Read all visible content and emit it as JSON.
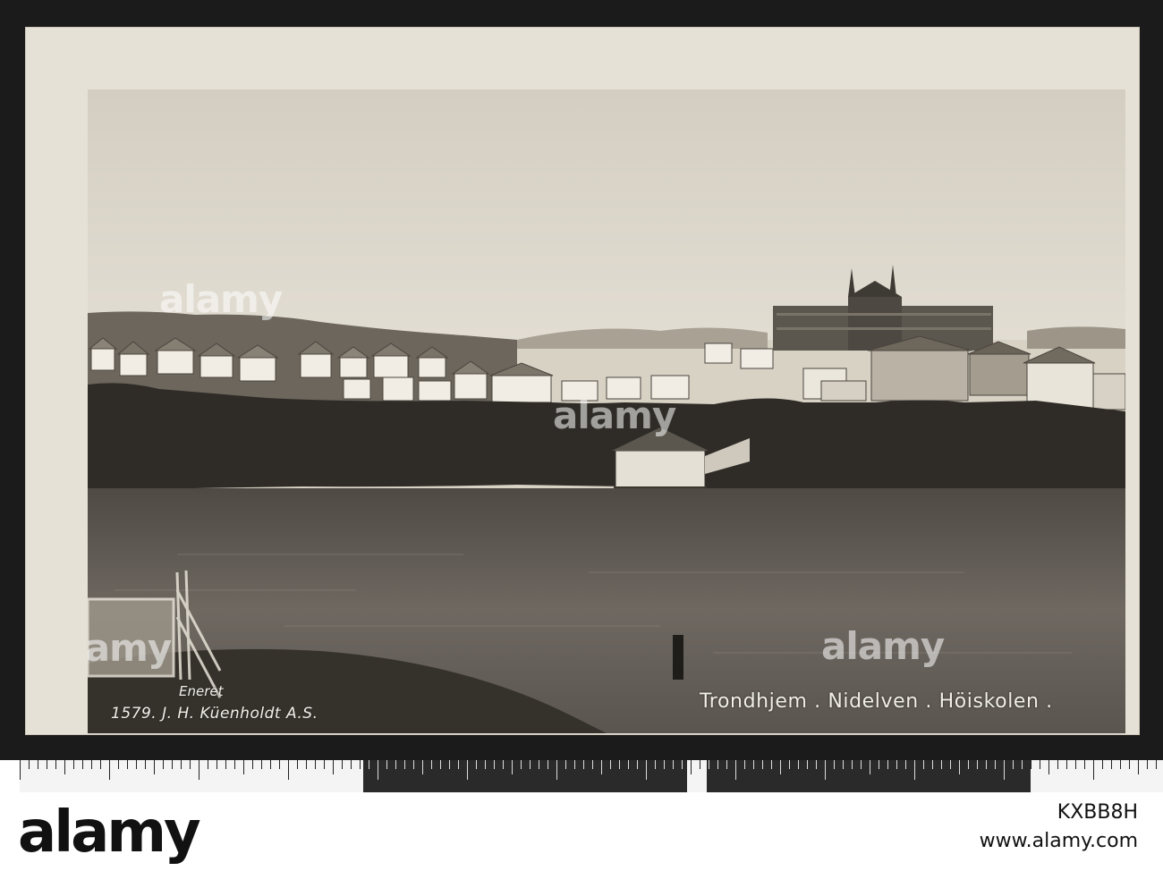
{
  "postcard": {
    "eneret": "Eneret",
    "publisher": "1579. J. H. Küenholdt A.S.",
    "title": "Trondhjem . Nidelven . Höiskolen ."
  },
  "watermark": {
    "text": "alamy"
  },
  "footer": {
    "brand": "alamy",
    "image_id": "KXBB8H",
    "url": "www.alamy.com"
  },
  "colors": {
    "sepia_sky": "#dcd6ca",
    "water": "#5c5650",
    "foliage": "#2e2b26",
    "card": "#e6e1d6",
    "scan_border": "#1b1b1b"
  }
}
